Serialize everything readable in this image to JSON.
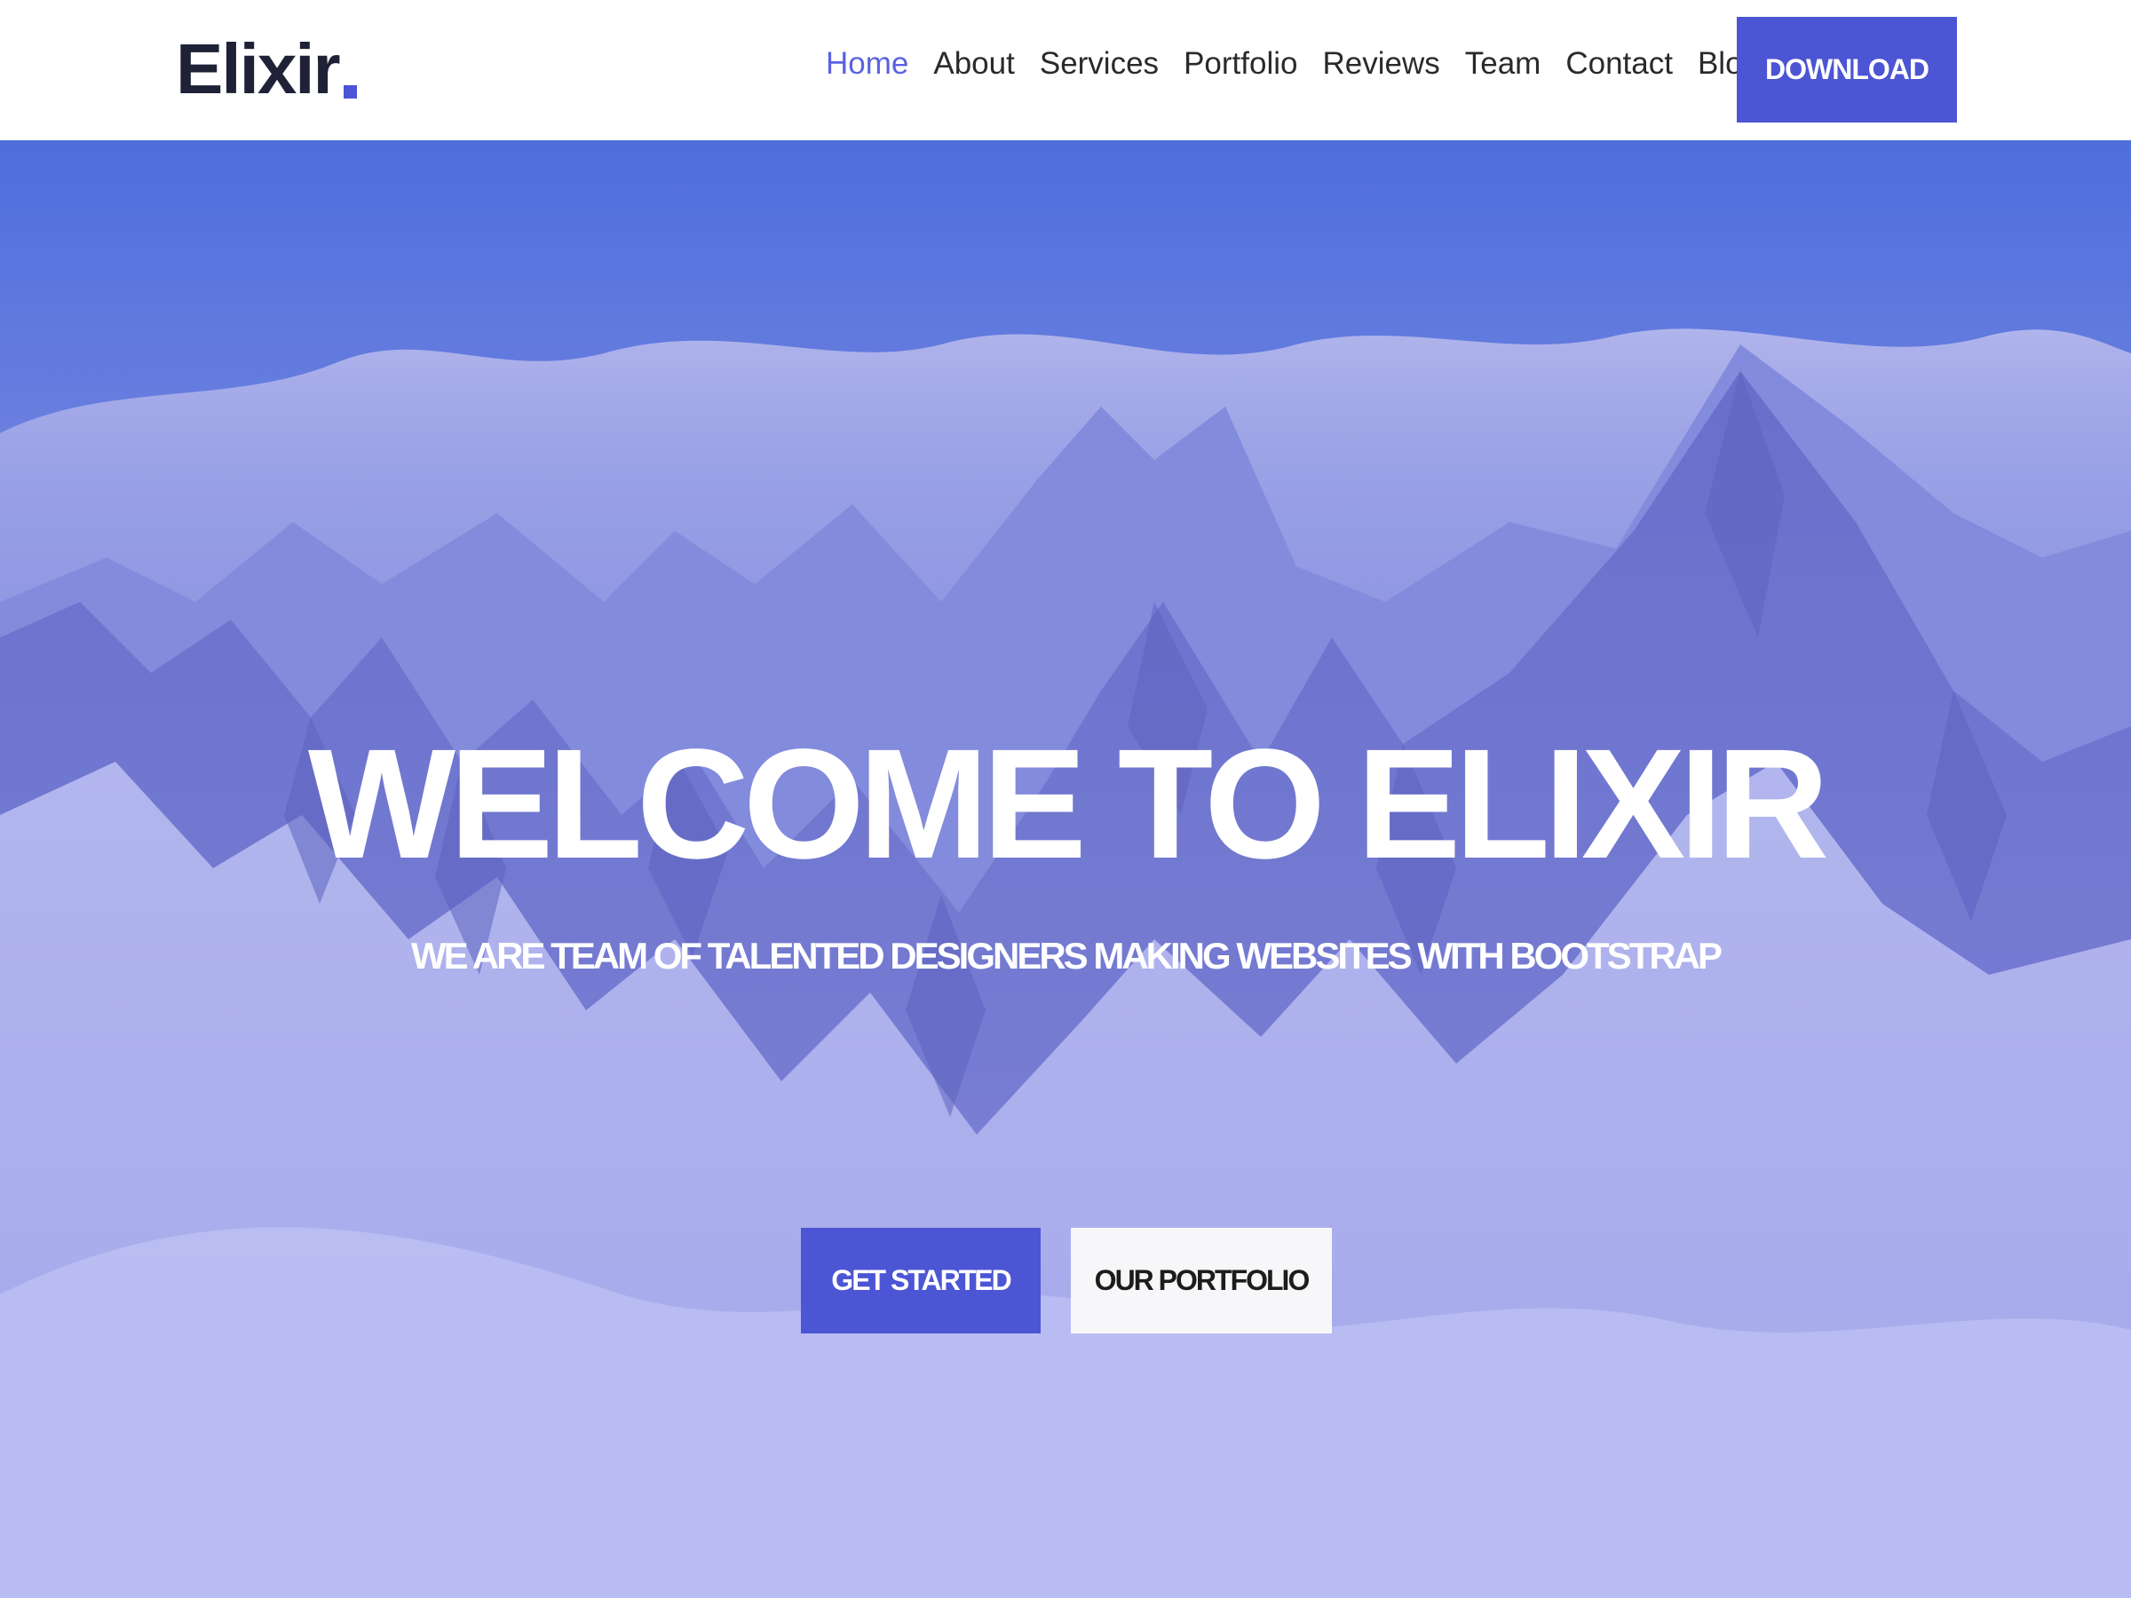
{
  "brand": {
    "name": "Elixir",
    "accent_color": "#4b55d6",
    "text_color": "#1f2236"
  },
  "nav": {
    "items": [
      {
        "label": "Home",
        "active": true
      },
      {
        "label": "About",
        "active": false
      },
      {
        "label": "Services",
        "active": false
      },
      {
        "label": "Portfolio",
        "active": false
      },
      {
        "label": "Reviews",
        "active": false
      },
      {
        "label": "Team",
        "active": false
      },
      {
        "label": "Contact",
        "active": false
      },
      {
        "label": "Blog",
        "active": false
      }
    ],
    "active_color": "#5a63e0",
    "download_label": "DOWNLOAD"
  },
  "hero": {
    "title": "WELCOME TO ELIXIR",
    "subtitle": "WE ARE TEAM OF TALENTED DESIGNERS MAKING WEBSITES WITH BOOTSTRAP",
    "primary_button": "GET STARTED",
    "secondary_button": "OUR PORTFOLIO",
    "background_image": "snowy-mountains-image"
  }
}
